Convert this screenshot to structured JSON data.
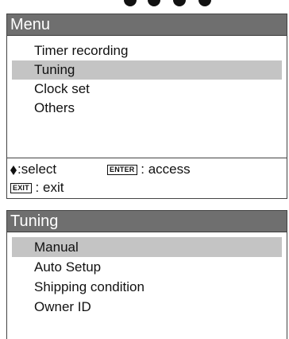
{
  "menu_panel": {
    "title": "Menu",
    "items": [
      {
        "label": "Timer recording",
        "selected": false
      },
      {
        "label": "Tuning",
        "selected": true
      },
      {
        "label": "Clock set",
        "selected": false
      },
      {
        "label": "Others",
        "selected": false
      }
    ],
    "help": {
      "select_icon": "up-down-diamond-icon",
      "select_label": ":select",
      "enter_key": "ENTER",
      "access_label": ": access",
      "exit_key": "EXIT",
      "exit_label": ": exit"
    }
  },
  "tuning_panel": {
    "title": "Tuning",
    "items": [
      {
        "label": "Manual",
        "selected": true
      },
      {
        "label": "Auto Setup",
        "selected": false
      },
      {
        "label": "Shipping condition",
        "selected": false
      },
      {
        "label": "Owner ID",
        "selected": false
      }
    ]
  },
  "colors": {
    "header_bg": "#6f6f6f",
    "header_text": "#ffffff",
    "selected_bg": "#c4c4c4",
    "border": "#444444"
  }
}
